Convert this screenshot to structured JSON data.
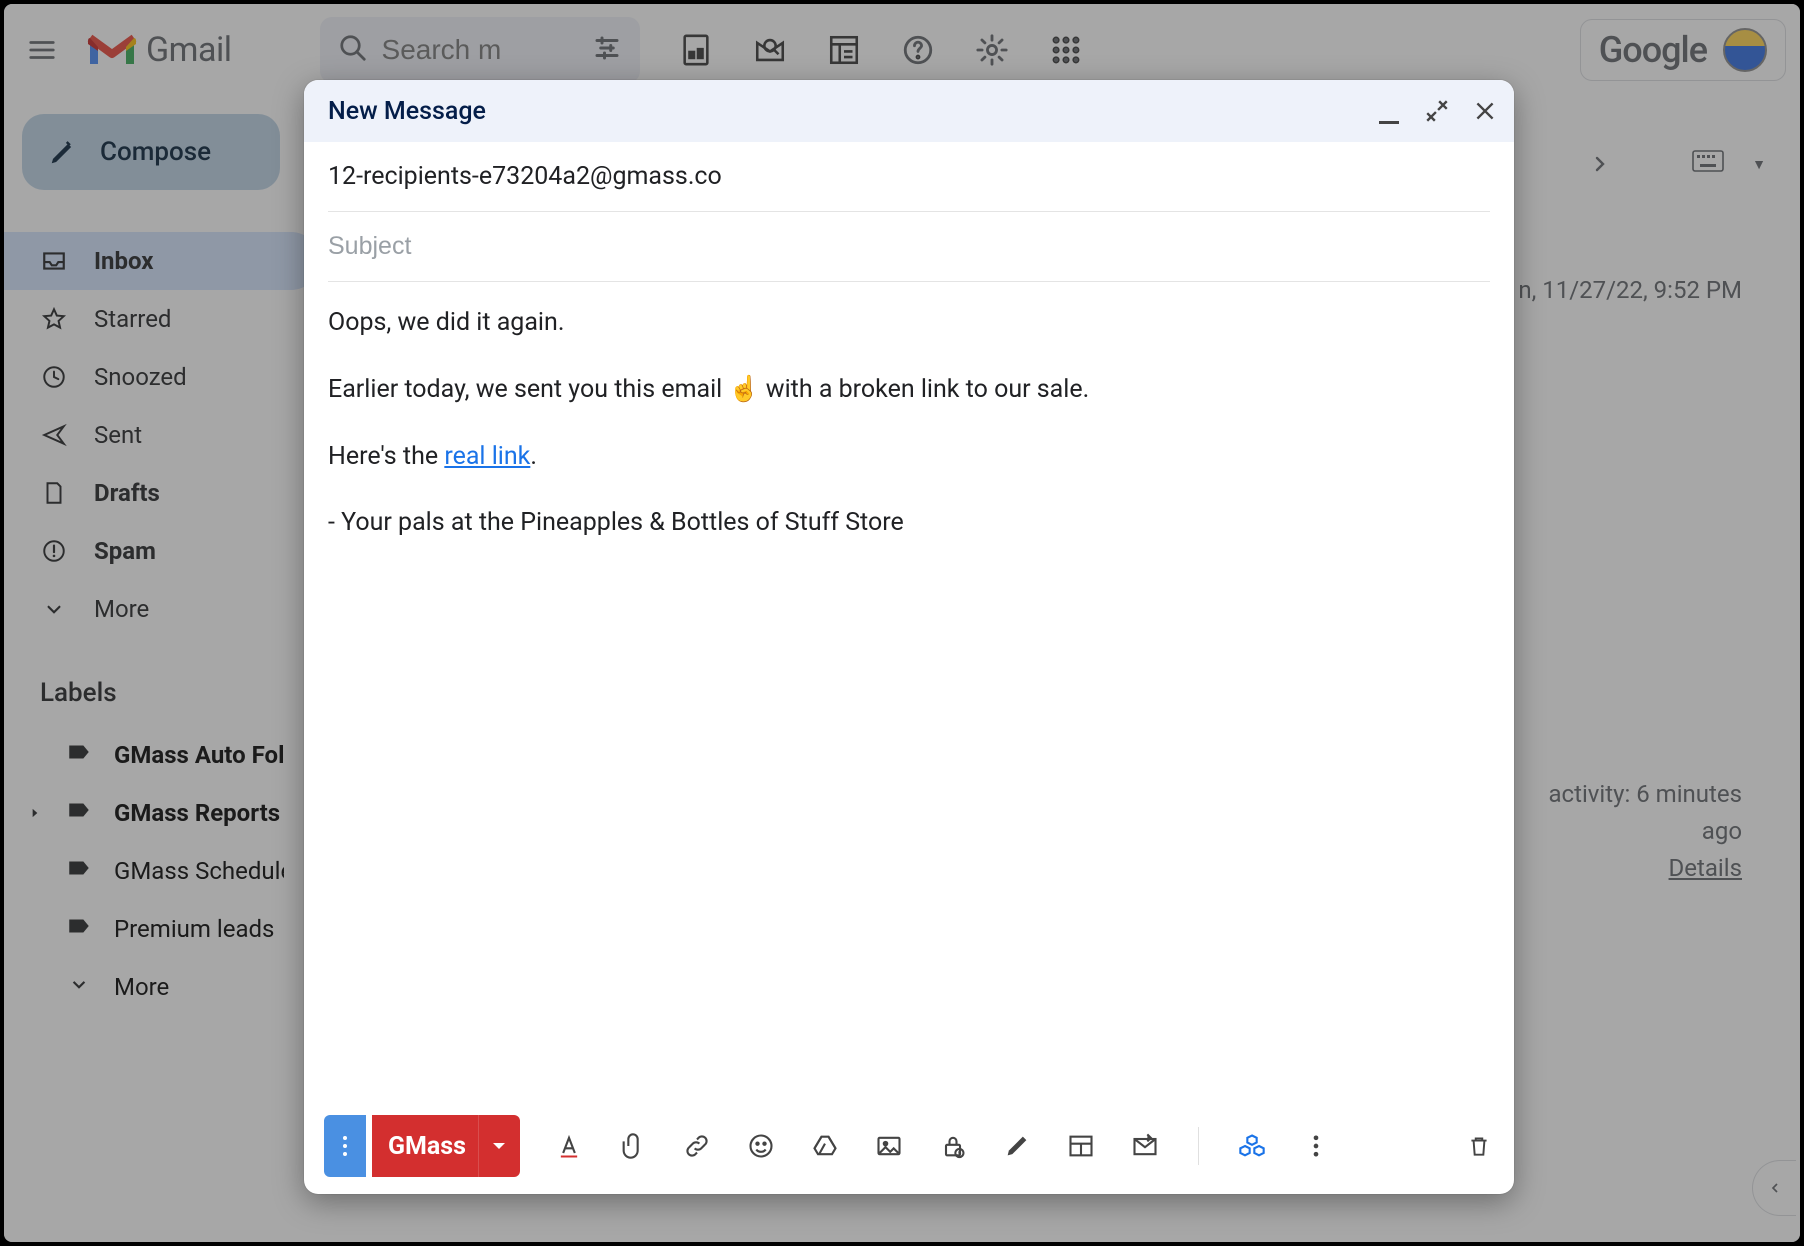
{
  "header": {
    "app_name": "Gmail",
    "search_placeholder": "Search m",
    "google_word": "Google"
  },
  "sidebar": {
    "compose_label": "Compose",
    "nav": [
      {
        "label": "Inbox",
        "active": true,
        "bold": true,
        "icon": "inbox"
      },
      {
        "label": "Starred",
        "active": false,
        "bold": false,
        "icon": "star"
      },
      {
        "label": "Snoozed",
        "active": false,
        "bold": false,
        "icon": "clock"
      },
      {
        "label": "Sent",
        "active": false,
        "bold": false,
        "icon": "send"
      },
      {
        "label": "Drafts",
        "active": false,
        "bold": true,
        "icon": "file"
      },
      {
        "label": "Spam",
        "active": false,
        "bold": true,
        "icon": "alert"
      },
      {
        "label": "More",
        "active": false,
        "bold": false,
        "icon": "chev"
      }
    ],
    "labels_heading": "Labels",
    "labels": [
      {
        "label": "GMass Auto Followups",
        "bold": true,
        "expandable": false
      },
      {
        "label": "GMass Reports",
        "bold": true,
        "expandable": true
      },
      {
        "label": "GMass Scheduled",
        "bold": false,
        "expandable": false
      },
      {
        "label": "Premium leads",
        "bold": false,
        "expandable": false
      }
    ],
    "labels_more": "More"
  },
  "main": {
    "datetime": "n, 11/27/22, 9:52 PM",
    "activity_line1": "activity: 6 minutes",
    "activity_line2": "ago",
    "details": "Details"
  },
  "compose": {
    "title": "New Message",
    "to": "12-recipients-e73204a2@gmass.co",
    "subject_placeholder": "Subject",
    "subject_value": "",
    "body": {
      "p1": "Oops, we did it again.",
      "p2_pre": "Earlier today, we sent you this email ",
      "p2_emoji": "☝️",
      "p2_post": " with a broken link to our sale.",
      "p3_pre": "Here's the ",
      "p3_link": "real link",
      "p3_post": ".",
      "p4": "- Your pals at the Pineapples & Bottles of Stuff Store"
    },
    "gmass_label": "GMass"
  }
}
